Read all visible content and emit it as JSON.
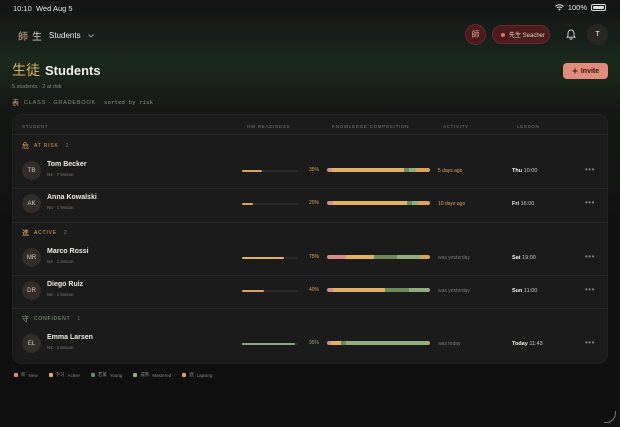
{
  "status_bar": {
    "time": "10:10",
    "date": "Wed Aug 5",
    "battery": "100%"
  },
  "top_bar": {
    "brand_glyph_1": "師",
    "brand_glyph_2": "生",
    "brand_label": "Students",
    "mode_glyph": "師",
    "teacher_label": "先生 Seacher",
    "avatar_initial": "T"
  },
  "header": {
    "title_kanji": "生徒",
    "title": "Students",
    "subtitle": "5 students · 2 at risk",
    "scope_kanji": "表",
    "scope_label": "CLASS · GRADEBOOK",
    "sort_label": "sorted by risk",
    "invite_label": "Invite"
  },
  "columns": {
    "student": "STUDENT",
    "hw_readiness": "HW READINESS",
    "knowledge": "KNOWLEDGE COMPOSITION",
    "activity": "ACTIVITY",
    "lesson": "LESSON"
  },
  "groups": [
    {
      "kanji": "危",
      "label": "AT RISK",
      "count": "2",
      "color": "#e0a15a",
      "students": [
        {
          "initials": "TB",
          "name": "Tom Becker",
          "meta": "N4 · 7 lesson",
          "hw": 0.35,
          "hw_pct": "35%",
          "hw_color": "#e0a15a",
          "activity": "5 days ago",
          "activity_color": "#e0a15a",
          "lesson_day": "Thu",
          "lesson_time": "10:00",
          "composition": [
            0.05,
            0.7,
            0.05,
            0.06,
            0.14
          ]
        },
        {
          "initials": "AK",
          "name": "Anna Kowalski",
          "meta": "N5 · 1 lesson",
          "hw": 0.2,
          "hw_pct": "20%",
          "hw_color": "#e0a15a",
          "activity": "10 days ago",
          "activity_color": "#e0a15a",
          "lesson_day": "Fri",
          "lesson_time": "16:00",
          "composition": [
            0.06,
            0.72,
            0.05,
            0.05,
            0.12
          ]
        }
      ]
    },
    {
      "kanji": "進",
      "label": "ACTIVE",
      "count": "2",
      "color": "#e2b262",
      "students": [
        {
          "initials": "MR",
          "name": "Marco Rossi",
          "meta": "N4 · 1 lesson",
          "hw": 0.75,
          "hw_pct": "75%",
          "hw_color": "#e2b262",
          "activity": "was yesterday",
          "activity_color": "#7f7d78",
          "lesson_day": "Sat",
          "lesson_time": "19:00",
          "composition": [
            0.18,
            0.28,
            0.22,
            0.22,
            0.1
          ]
        },
        {
          "initials": "DR",
          "name": "Diego Ruiz",
          "meta": "N5 · 1 lesson",
          "hw": 0.4,
          "hw_pct": "40%",
          "hw_color": "#e0a15a",
          "activity": "was yesterday",
          "activity_color": "#7f7d78",
          "lesson_day": "Sun",
          "lesson_time": "11:00",
          "composition": [
            0.06,
            0.5,
            0.24,
            0.2,
            0.0
          ]
        }
      ]
    },
    {
      "kanji": "守",
      "label": "CONFIDENT",
      "count": "1",
      "color": "#8fa884",
      "students": [
        {
          "initials": "EL",
          "name": "Emma Larsen",
          "meta": "N4 · 1 lesson",
          "hw": 0.95,
          "hw_pct": "95%",
          "hw_color": "#8fa884",
          "activity": "was today",
          "activity_color": "#7f7d78",
          "lesson_day": "Today",
          "lesson_time": "11:43",
          "composition": [
            0.04,
            0.1,
            0.04,
            0.8,
            0.02
          ]
        }
      ]
    }
  ],
  "legend": [
    {
      "glyph": "新",
      "label": "New",
      "color": "#d98c8c"
    },
    {
      "glyph": "学习",
      "label": "Active",
      "color": "#e2b262"
    },
    {
      "glyph": "若葉",
      "label": "Young",
      "color": "#6e8a56"
    },
    {
      "glyph": "成熟",
      "label": "Mastered",
      "color": "#8fb07c"
    },
    {
      "glyph": "遅",
      "label": "Lapsing",
      "color": "#e0a15a"
    }
  ],
  "composition_colors": [
    "#d98c8c",
    "#e2b262",
    "#6e8a56",
    "#8fb07c",
    "#e0a15a"
  ],
  "icons": [
    "wifi-icon",
    "battery-icon",
    "chevron-down-icon",
    "bell-icon",
    "plus-icon",
    "more-icon"
  ]
}
